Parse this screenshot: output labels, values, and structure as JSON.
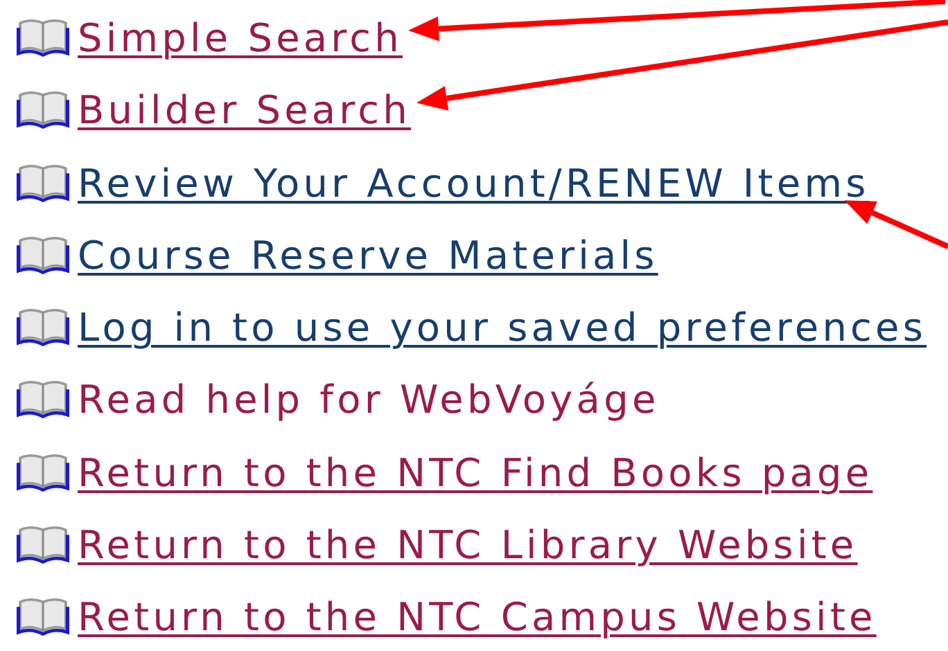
{
  "links": [
    {
      "label": "Simple Search",
      "kind": "link",
      "visited": true,
      "marked": true
    },
    {
      "label": "Builder Search",
      "kind": "link",
      "visited": true,
      "marked": true
    },
    {
      "label": "Review Your Account/RENEW Items",
      "kind": "link",
      "visited": false,
      "marked": true
    },
    {
      "label": "Course Reserve Materials",
      "kind": "link",
      "visited": false,
      "marked": false
    },
    {
      "label": "Log in to use your saved preferences",
      "kind": "link",
      "visited": false,
      "marked": false
    },
    {
      "label": "Read help for WebVoyáge",
      "kind": "text",
      "visited": true,
      "marked": false
    },
    {
      "label": "Return to the NTC Find Books page",
      "kind": "link",
      "visited": true,
      "marked": false
    },
    {
      "label": "Return to the NTC Library Website",
      "kind": "link",
      "visited": true,
      "marked": false
    },
    {
      "label": "Return to the NTC Campus Website",
      "kind": "link",
      "visited": true,
      "marked": false
    }
  ]
}
